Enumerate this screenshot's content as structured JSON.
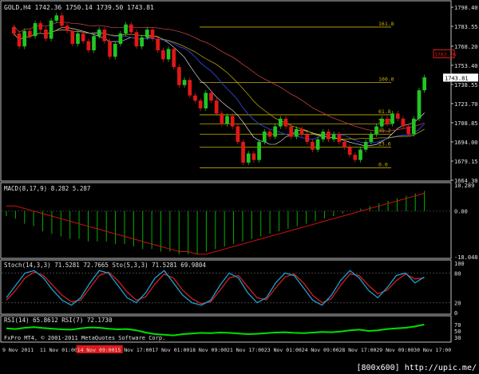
{
  "colors": {
    "background": "#000000",
    "frame": "#c0c0c0",
    "grid": "#2a2a2a",
    "bull_candle": "#22c622",
    "bear_candle": "#e01818",
    "label_text": "#e0e0e0",
    "fib_line": "#c8b400",
    "macd_signal": "#d01010",
    "macd_hist": "#00b000",
    "stoch_main": "#1f9fd0",
    "stoch_signal": "#d02020",
    "stoch_slow": "#d0a020",
    "rsi_line": "#00e000",
    "price_tag": "#ffffff"
  },
  "main_chart": {
    "header": "GOLD,H4  1742.36 1750.14 1739.50 1743.81",
    "y_ticks": [
      "1798.40",
      "1783.55",
      "1768.20",
      "1753.40",
      "1738.55",
      "1723.70",
      "1708.85",
      "1694.00",
      "1679.15",
      "1664.30"
    ],
    "y_range": [
      1664.3,
      1798.4
    ],
    "current_price": "1743.81",
    "high_price_tag": "1762.26",
    "fib_levels": [
      {
        "label": "161.8",
        "price": 1783.0
      },
      {
        "label": "100.0",
        "price": 1740.0
      },
      {
        "label": "61.8",
        "price": 1715.0
      },
      {
        "label": "50.0",
        "price": 1708.0
      },
      {
        "label": "38.2",
        "price": 1700.0
      },
      {
        "label": "23.6",
        "price": 1690.0
      },
      {
        "label": "0.0",
        "price": 1674.0
      }
    ],
    "candles": [
      [
        1783,
        1778
      ],
      [
        1778,
        1768
      ],
      [
        1768,
        1780
      ],
      [
        1780,
        1776
      ],
      [
        1776,
        1786
      ],
      [
        1786,
        1781
      ],
      [
        1781,
        1774
      ],
      [
        1774,
        1788
      ],
      [
        1788,
        1792
      ],
      [
        1792,
        1784
      ],
      [
        1784,
        1780
      ],
      [
        1780,
        1770
      ],
      [
        1770,
        1778
      ],
      [
        1778,
        1772
      ],
      [
        1772,
        1765
      ],
      [
        1765,
        1776
      ],
      [
        1776,
        1781
      ],
      [
        1781,
        1772
      ],
      [
        1772,
        1760
      ],
      [
        1760,
        1770
      ],
      [
        1770,
        1778
      ],
      [
        1778,
        1785
      ],
      [
        1785,
        1779
      ],
      [
        1779,
        1768
      ],
      [
        1768,
        1775
      ],
      [
        1775,
        1781
      ],
      [
        1781,
        1774
      ],
      [
        1774,
        1765
      ],
      [
        1765,
        1758
      ],
      [
        1758,
        1766
      ],
      [
        1766,
        1752
      ],
      [
        1752,
        1738
      ],
      [
        1738,
        1742
      ],
      [
        1742,
        1730
      ],
      [
        1730,
        1726
      ],
      [
        1726,
        1720
      ],
      [
        1720,
        1732
      ],
      [
        1732,
        1726
      ],
      [
        1726,
        1716
      ],
      [
        1716,
        1708
      ],
      [
        1708,
        1714
      ],
      [
        1714,
        1706
      ],
      [
        1706,
        1694
      ],
      [
        1694,
        1678
      ],
      [
        1678,
        1685
      ],
      [
        1685,
        1680
      ],
      [
        1680,
        1694
      ],
      [
        1694,
        1702
      ],
      [
        1702,
        1698
      ],
      [
        1698,
        1706
      ],
      [
        1706,
        1712
      ],
      [
        1712,
        1706
      ],
      [
        1706,
        1698
      ],
      [
        1698,
        1704
      ],
      [
        1704,
        1700
      ],
      [
        1700,
        1694
      ],
      [
        1694,
        1688
      ],
      [
        1688,
        1696
      ],
      [
        1696,
        1702
      ],
      [
        1702,
        1696
      ],
      [
        1696,
        1700
      ],
      [
        1700,
        1694
      ],
      [
        1694,
        1690
      ],
      [
        1690,
        1684
      ],
      [
        1684,
        1680
      ],
      [
        1680,
        1688
      ],
      [
        1688,
        1694
      ],
      [
        1694,
        1700
      ],
      [
        1700,
        1706
      ],
      [
        1706,
        1712
      ],
      [
        1712,
        1708
      ],
      [
        1708,
        1716
      ],
      [
        1716,
        1712
      ],
      [
        1712,
        1706
      ],
      [
        1706,
        1700
      ],
      [
        1700,
        1712
      ],
      [
        1712,
        1734
      ],
      [
        1734,
        1744
      ]
    ]
  },
  "macd_panel": {
    "label": "MACD(8,17,9) 8.282 5.287",
    "y_ticks": [
      "10.289",
      "0.00",
      "-18.048"
    ],
    "y_range": [
      -18.048,
      10.289
    ],
    "hist": [
      -2,
      -3,
      -5,
      -6,
      -8,
      -9,
      -10,
      -11,
      -11,
      -12,
      -12,
      -12,
      -13,
      -13,
      -14,
      -15,
      -15,
      -16,
      -16,
      -17,
      -17,
      -17,
      -16,
      -15,
      -14,
      -13,
      -12,
      -11,
      -10,
      -9,
      -8,
      -7,
      -6,
      -5,
      -4,
      -3,
      -2,
      -1,
      0,
      1,
      2,
      3,
      4,
      5,
      6,
      7,
      8
    ],
    "signal": [
      2,
      2,
      1,
      0,
      -1,
      -2,
      -3,
      -4,
      -5,
      -6,
      -7,
      -8,
      -9,
      -10,
      -11,
      -12,
      -13,
      -14,
      -15,
      -16,
      -16,
      -17,
      -17,
      -16,
      -15,
      -14,
      -13,
      -12,
      -11,
      -10,
      -9,
      -8,
      -7,
      -6,
      -5,
      -4,
      -3,
      -2,
      -1,
      0,
      1,
      2,
      3,
      4,
      5,
      6,
      7
    ]
  },
  "stoch_panel": {
    "label": "Stoch(14,3,3) 71.5281 72.7665  Sto(5,3,3) 71.5281 69.9804",
    "y_ticks": [
      "100",
      "80",
      "20",
      "0"
    ],
    "main": [
      30,
      55,
      80,
      85,
      70,
      45,
      25,
      15,
      30,
      60,
      85,
      80,
      55,
      30,
      20,
      40,
      70,
      85,
      60,
      35,
      20,
      15,
      25,
      55,
      80,
      70,
      40,
      20,
      30,
      60,
      80,
      75,
      50,
      25,
      15,
      35,
      65,
      85,
      70,
      45,
      30,
      50,
      75,
      80,
      60,
      72
    ],
    "signal": [
      25,
      45,
      70,
      82,
      75,
      55,
      35,
      22,
      25,
      50,
      75,
      82,
      65,
      42,
      25,
      32,
      58,
      78,
      70,
      45,
      28,
      18,
      22,
      45,
      70,
      75,
      52,
      30,
      26,
      50,
      72,
      78,
      60,
      35,
      20,
      28,
      55,
      78,
      75,
      55,
      38,
      45,
      65,
      78,
      68,
      70
    ]
  },
  "rsi_panel": {
    "label": "RSI(14) 65.8612  RSI(7) 72.1730",
    "y_ticks": [
      "70",
      "50",
      "30"
    ],
    "values": [
      58,
      56,
      60,
      62,
      59,
      57,
      55,
      54,
      58,
      61,
      60,
      57,
      55,
      56,
      52,
      45,
      40,
      38,
      36,
      40,
      42,
      44,
      43,
      45,
      44,
      42,
      40,
      41,
      43,
      45,
      46,
      44,
      43,
      45,
      47,
      46,
      48,
      52,
      54,
      50,
      52,
      56,
      58,
      60,
      64,
      70
    ]
  },
  "time_axis": {
    "labels": [
      "9 Nov 2011",
      "11 Nov 01:00",
      "14 Nov 09:00",
      "15 Nov 17:00",
      "17 Nov 01:00",
      "18 Nov 09:00",
      "21 Nov 17:00",
      "23 Nov 01:00",
      "24 Nov 09:00",
      "28 Nov 17:00",
      "29 Nov 09:00",
      "30 Nov 17:00"
    ],
    "highlighted": "14 Nov 09:00"
  },
  "footer": {
    "copyright": "FxPro MT4, © 2001-2011 MetaQuotes Software Corp.",
    "watermark": "[800x600] http://upic.me/"
  }
}
